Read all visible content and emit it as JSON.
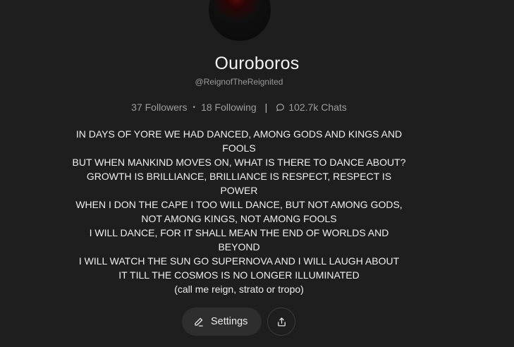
{
  "profile": {
    "name": "Ouroboros",
    "handle": "@ReignofTheReignited"
  },
  "stats": {
    "followers": "37 Followers",
    "separator_dot": "•",
    "following": "18 Following",
    "separator_pipe": "|",
    "chats": "102.7k Chats",
    "chat_icon": "speech-bubble-icon"
  },
  "bio": {
    "lines": [
      "IN DAYS OF YORE WE HAD DANCED, AMONG GODS AND KINGS AND",
      "FOOLS",
      "BUT WHEN MANKIND MOVES ON, WHAT IS THERE TO DANCE ABOUT?",
      "GROWTH IS BRILLIANCE, BRILLIANCE IS RESPECT, RESPECT IS",
      "POWER",
      "WHEN I DON THE CAPE I TOO WILL DANCE, BUT NOT AMONG GODS,",
      "NOT AMONG KINGS, NOT AMONG FOOLS",
      "I WILL DANCE, FOR IT SHALL MEAN THE END OF WORLDS AND",
      "BEYOND",
      "I WILL WATCH THE SUN GO SUPERNOVA AND I WILL LAUGH ABOUT",
      "IT TILL THE COSMOS IS NO LONGER ILLUMINATED",
      "(call me reign, strato or tropo)"
    ]
  },
  "actions": {
    "settings_label": "Settings",
    "settings_icon": "pencil-icon",
    "share_icon": "share-icon"
  },
  "colors": {
    "background": "#1e1e1e",
    "button_bg": "#2e2e2e",
    "muted_text": "#9e9e9e"
  }
}
